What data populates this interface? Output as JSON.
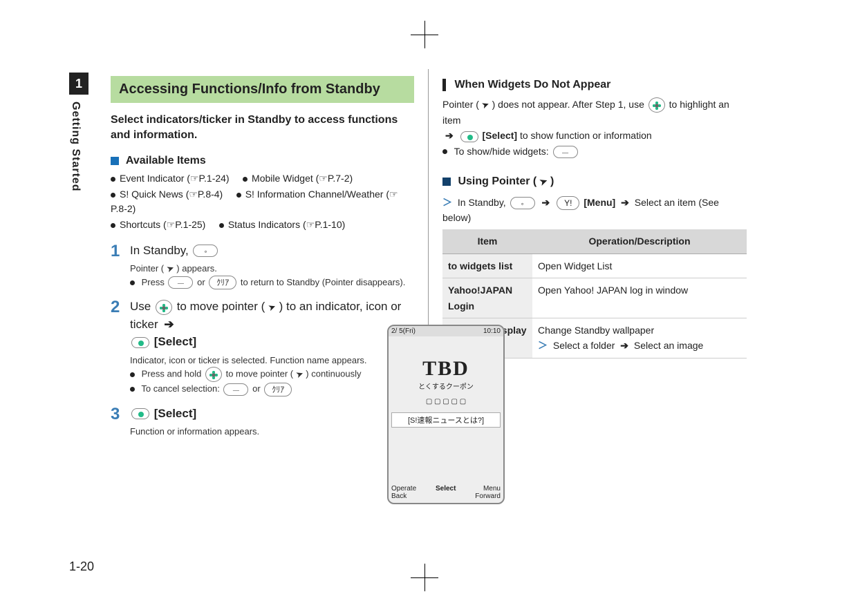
{
  "side_tab": {
    "num": "1",
    "label": "Getting Started"
  },
  "page_num": "1-20",
  "left": {
    "section_title": "Accessing Functions/Info from Standby",
    "intro": "Select indicators/ticker in Standby to access functions and information.",
    "available_label": "Available Items",
    "available": [
      "Event Indicator (☞P.1-24)",
      "Mobile Widget (☞P.7-2)",
      "S! Quick News (☞P.8-4)",
      "S! Information Channel/Weather (☞P.8-2)",
      "Shortcuts (☞P.1-25)",
      "Status Indicators (☞P.1-10)"
    ],
    "steps": {
      "s1": {
        "main_a": "In Standby, ",
        "sub_a": "Pointer ( ",
        "sub_b": " ) appears.",
        "note": "Press ",
        "note_b": " or ",
        "note_c": " to return to Standby (Pointer disappears)."
      },
      "s2": {
        "main_a": "Use ",
        "main_b": " to move pointer ( ",
        "main_c": " ) to an indicator, icon or ticker ",
        "select": "[Select]",
        "sub": "Indicator, icon or ticker is selected. Function name appears.",
        "note_a": "Press and hold ",
        "note_b": " to move pointer ( ",
        "note_c": " ) continuously",
        "note2_a": "To cancel selection: ",
        "note2_b": " or "
      },
      "s3": {
        "select": "[Select]",
        "sub": "Function or information appears."
      }
    },
    "phone": {
      "date": "2/ 5(Fri)",
      "time": "10:10",
      "tbd": "TBD",
      "jp1": "とくするクーポン",
      "ticker": "[S!速報ニュースとは?]",
      "sk_left_top": "Operate",
      "sk_left_bot": "Back",
      "sk_mid": "Select",
      "sk_right_top": "Menu",
      "sk_right_bot": "Forward"
    }
  },
  "right": {
    "box1": {
      "head": "When Widgets Do Not Appear",
      "line1_a": "Pointer ( ",
      "line1_b": " ) does not appear. After Step 1, use ",
      "line1_c": " to highlight an item",
      "line2": "[Select]",
      "line2_b": " to show function or information",
      "note": "To show/hide widgets: "
    },
    "box2": {
      "head_a": "Using Pointer ( ",
      "head_b": " )",
      "line_a": "In Standby, ",
      "menu": "[Menu]",
      "line_b": " Select an item (See below)"
    },
    "table": {
      "h1": "Item",
      "h2": "Operation/Description",
      "rows": [
        {
          "item": "to widgets list",
          "desc": "Open Widget List"
        },
        {
          "item": "Yahoo!JAPAN Login",
          "desc": "Open Yahoo! JAPAN log in window"
        },
        {
          "item": "Stand-by Display",
          "desc_a": "Change Standby wallpaper",
          "desc_b": "Select a folder ",
          "desc_c": " Select an image"
        }
      ]
    }
  }
}
